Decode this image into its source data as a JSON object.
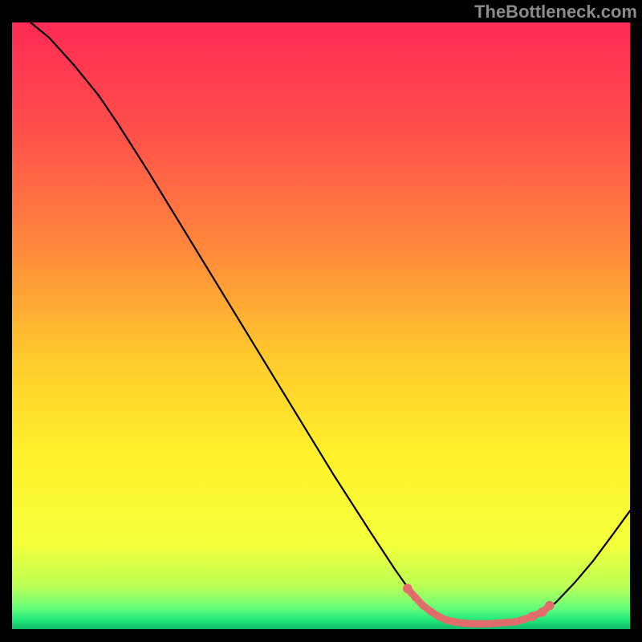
{
  "watermark": "TheBottleneck.com",
  "chart_data": {
    "type": "line",
    "title": "",
    "xlabel": "",
    "ylabel": "",
    "xlim": [
      0,
      100
    ],
    "ylim": [
      0,
      100
    ],
    "gradient_stops": [
      {
        "offset": 0.0,
        "color": "#ff2a55"
      },
      {
        "offset": 0.18,
        "color": "#ff4f4a"
      },
      {
        "offset": 0.38,
        "color": "#ff8a3a"
      },
      {
        "offset": 0.55,
        "color": "#ffc92c"
      },
      {
        "offset": 0.72,
        "color": "#fff22a"
      },
      {
        "offset": 0.86,
        "color": "#f4ff3a"
      },
      {
        "offset": 0.93,
        "color": "#baff55"
      },
      {
        "offset": 0.965,
        "color": "#66ff7a"
      },
      {
        "offset": 0.985,
        "color": "#20e878"
      },
      {
        "offset": 1.0,
        "color": "#0fb86a"
      }
    ],
    "series": [
      {
        "name": "curve",
        "stroke": "#000000",
        "stroke_width": 2.2,
        "points": [
          {
            "x": 3.0,
            "y": 100.0
          },
          {
            "x": 6.0,
            "y": 97.5
          },
          {
            "x": 10.0,
            "y": 93.0
          },
          {
            "x": 14.0,
            "y": 88.0
          },
          {
            "x": 17.0,
            "y": 83.5
          },
          {
            "x": 22.0,
            "y": 75.5
          },
          {
            "x": 28.0,
            "y": 65.5
          },
          {
            "x": 34.0,
            "y": 55.5
          },
          {
            "x": 40.0,
            "y": 45.5
          },
          {
            "x": 46.0,
            "y": 35.5
          },
          {
            "x": 52.0,
            "y": 25.5
          },
          {
            "x": 58.0,
            "y": 16.0
          },
          {
            "x": 62.0,
            "y": 9.8
          },
          {
            "x": 64.5,
            "y": 6.2
          },
          {
            "x": 67.0,
            "y": 3.4
          },
          {
            "x": 70.0,
            "y": 1.6
          },
          {
            "x": 74.0,
            "y": 0.9
          },
          {
            "x": 78.0,
            "y": 0.9
          },
          {
            "x": 82.0,
            "y": 1.2
          },
          {
            "x": 85.0,
            "y": 2.2
          },
          {
            "x": 88.0,
            "y": 4.4
          },
          {
            "x": 91.0,
            "y": 7.6
          },
          {
            "x": 94.0,
            "y": 11.2
          },
          {
            "x": 97.0,
            "y": 15.3
          },
          {
            "x": 100.0,
            "y": 19.5
          }
        ]
      }
    ],
    "scatter": {
      "name": "highlight-points",
      "color": "#e36b6b",
      "radius_small": 4.8,
      "radius_large": 5.8,
      "points": [
        {
          "x": 64.0,
          "y": 6.7,
          "r": "large"
        },
        {
          "x": 65.3,
          "y": 5.2,
          "r": "small"
        },
        {
          "x": 66.5,
          "y": 3.9,
          "r": "small"
        },
        {
          "x": 67.8,
          "y": 2.9,
          "r": "small"
        },
        {
          "x": 69.0,
          "y": 2.1,
          "r": "small"
        },
        {
          "x": 70.3,
          "y": 1.5,
          "r": "small"
        },
        {
          "x": 71.6,
          "y": 1.2,
          "r": "small"
        },
        {
          "x": 73.0,
          "y": 1.0,
          "r": "small"
        },
        {
          "x": 74.4,
          "y": 0.9,
          "r": "small"
        },
        {
          "x": 75.8,
          "y": 0.9,
          "r": "small"
        },
        {
          "x": 77.2,
          "y": 0.9,
          "r": "small"
        },
        {
          "x": 78.6,
          "y": 1.0,
          "r": "small"
        },
        {
          "x": 80.0,
          "y": 1.1,
          "r": "small"
        },
        {
          "x": 81.4,
          "y": 1.2,
          "r": "small"
        },
        {
          "x": 82.8,
          "y": 1.6,
          "r": "small"
        },
        {
          "x": 84.2,
          "y": 2.1,
          "r": "large"
        },
        {
          "x": 85.8,
          "y": 2.8,
          "r": "large"
        },
        {
          "x": 87.0,
          "y": 3.9,
          "r": "large"
        }
      ]
    }
  }
}
